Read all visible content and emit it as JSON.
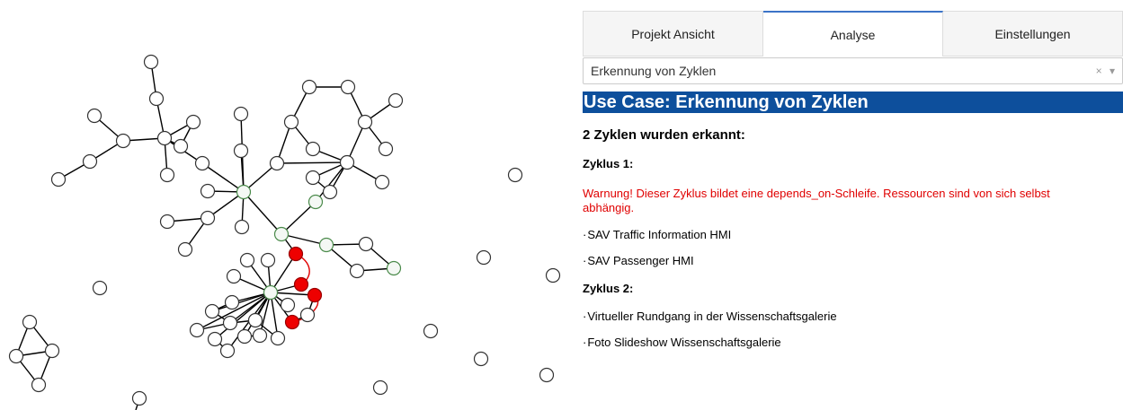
{
  "tabs": [
    {
      "label": "Projekt Ansicht",
      "active": false
    },
    {
      "label": "Analyse",
      "active": true
    },
    {
      "label": "Einstellungen",
      "active": false
    }
  ],
  "use_case_select": {
    "value": "Erkennung von Zyklen",
    "clear_glyph": "×",
    "arrow_glyph": "▾"
  },
  "banner": "Use Case: Erkennung von Zyklen",
  "summary": "2 Zyklen wurden erkannt:",
  "cycles": [
    {
      "title": "Zyklus 1:",
      "warning": "Warnung! Dieser Zyklus bildet eine depends_on-Schleife. Ressourcen sind von sich selbst abhängig.",
      "items": [
        "SAV Traffic Information HMI",
        "SAV Passenger HMI"
      ]
    },
    {
      "title": "Zyklus 2:",
      "items": [
        "Virtueller Rundgang in der Wissenschaftsgalerie",
        "Foto Slideshow Wissenschaftsgalerie"
      ]
    }
  ],
  "bullet": "·",
  "colors": {
    "banner": "#0d4f9c",
    "warning": "#e00000",
    "cycle_node": "#ee0000",
    "highlight_node_border": "#4a8a4a",
    "active_tab_border": "#3b73c7"
  }
}
